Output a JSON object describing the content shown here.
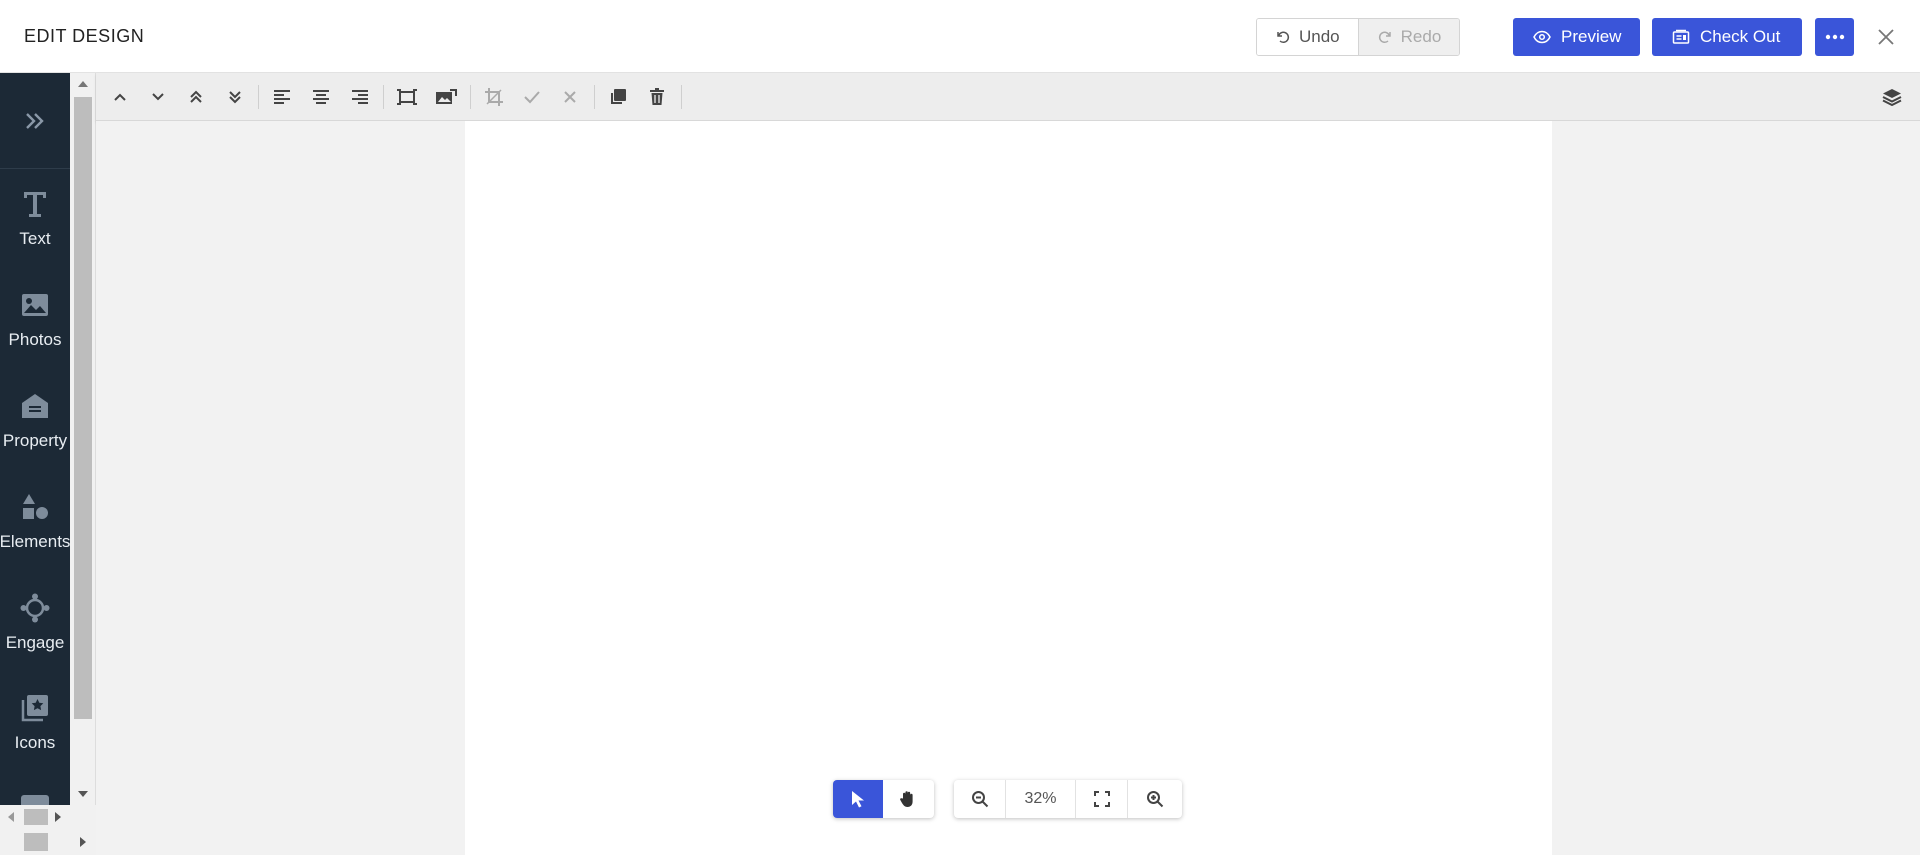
{
  "header": {
    "title": "EDIT DESIGN",
    "undo_label": "Undo",
    "redo_label": "Redo",
    "preview_label": "Preview",
    "checkout_label": "Check Out"
  },
  "sidebar": {
    "items": [
      {
        "label": "Text",
        "icon": "text-icon"
      },
      {
        "label": "Photos",
        "icon": "image-icon"
      },
      {
        "label": "Property",
        "icon": "house-icon"
      },
      {
        "label": "Elements",
        "icon": "shapes-icon"
      },
      {
        "label": "Engage",
        "icon": "engage-icon"
      },
      {
        "label": "Icons",
        "icon": "icon-library-icon"
      }
    ]
  },
  "toolbar": {
    "tools": [
      "move-up-icon",
      "move-down-icon",
      "bring-to-front-icon",
      "send-to-back-icon",
      "align-left-icon",
      "align-center-icon",
      "align-right-icon",
      "fit-frame-icon",
      "replace-image-icon",
      "crop-icon",
      "confirm-icon",
      "cancel-icon",
      "duplicate-icon",
      "delete-icon",
      "layers-icon"
    ]
  },
  "zoom": {
    "value": "32%"
  },
  "colors": {
    "accent": "#3a55d9",
    "sidebar": "#1c2936"
  }
}
